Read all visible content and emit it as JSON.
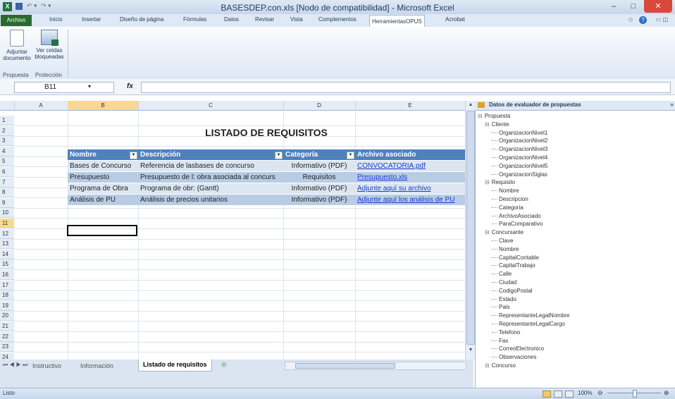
{
  "window": {
    "title": "BASESDEP.con.xls  [Nodo de compatibilidad] - Microsoft Excel",
    "minimize": "–",
    "maximize": "□",
    "close": "✕"
  },
  "menu": {
    "tabs": [
      "Archivo",
      "Inicio",
      "Insertar",
      "Diseño de página",
      "Fórmulas",
      "Datos",
      "Revisar",
      "Vista",
      "Complementos",
      "HerramientasOPUS",
      "Acrobat"
    ]
  },
  "ribbon": {
    "btn_attach": [
      "Adjuntar",
      "documento"
    ],
    "btn_locked": [
      "Ver celdas",
      "bloqueadas"
    ],
    "group_propuesta": "Propuesta",
    "group_proteccion": "Protección"
  },
  "formula": {
    "name_box": "B11",
    "fx": "fx",
    "value": ""
  },
  "grid": {
    "columns": [
      "A",
      "B",
      "C",
      "D",
      "E"
    ],
    "rows": [
      "1",
      "2",
      "3",
      "4",
      "5",
      "6",
      "7",
      "8",
      "9",
      "10",
      "11",
      "12",
      "13",
      "14",
      "15",
      "16",
      "17",
      "18",
      "19",
      "20",
      "21",
      "22",
      "23",
      "24"
    ],
    "title": "LISTADO DE REQUISITOS",
    "table_headers": [
      "Nombre",
      "Descripción",
      "Categoría",
      "Archivo asociado"
    ],
    "table_rows": [
      [
        "Bases de Concurso",
        "Referencia de lasbases de concurso",
        "Informativo (PDF)",
        "CONVOCATORIA.pdf"
      ],
      [
        "Presupuesto",
        "Presupuesto de l: obra asociada al concurs",
        "Requisitos",
        "Presupuesto.xls"
      ],
      [
        "Programa de Obra",
        "Programa de obr: (Gantt)",
        "Informativo (PDF)",
        "Adjunte aquí su archivo"
      ],
      [
        "Análisis de PU",
        "Análisis de precios unitarios",
        "Informativo (PDF)",
        "Adjunte aquí los análisis de PU"
      ]
    ]
  },
  "sheets": {
    "tabs": [
      "Instructivo",
      "Información",
      "Listado de requisitos"
    ]
  },
  "xml_pane": {
    "title": "Datos de evaluador de propuestas",
    "tree": [
      {
        "label": "Propuesta",
        "level": 0,
        "toggle": "⊟"
      },
      {
        "label": "Cliente",
        "level": 1,
        "toggle": "⊟"
      },
      {
        "label": "OrganizacionNivel1",
        "level": 2
      },
      {
        "label": "OrganizacionNivel2",
        "level": 2
      },
      {
        "label": "OrganizacionNivel3",
        "level": 2
      },
      {
        "label": "OrganizacionNivel4",
        "level": 2
      },
      {
        "label": "OrganizacionNivel5",
        "level": 2
      },
      {
        "label": "OrganizacionSiglas",
        "level": 2
      },
      {
        "label": "Requisito",
        "level": 1,
        "toggle": "⊟"
      },
      {
        "label": "Nombre",
        "level": 2
      },
      {
        "label": "Descripcion",
        "level": 2
      },
      {
        "label": "Categoria",
        "level": 2
      },
      {
        "label": "ArchivoAsociado",
        "level": 2
      },
      {
        "label": "ParaComparativo",
        "level": 2
      },
      {
        "label": "Concursante",
        "level": 1,
        "toggle": "⊟"
      },
      {
        "label": "Clave",
        "level": 2
      },
      {
        "label": "Nombre",
        "level": 2
      },
      {
        "label": "CapitalContable",
        "level": 2
      },
      {
        "label": "CapitalTrabajo",
        "level": 2
      },
      {
        "label": "Calle",
        "level": 2
      },
      {
        "label": "Ciudad",
        "level": 2
      },
      {
        "label": "CodigoPostal",
        "level": 2
      },
      {
        "label": "Estado",
        "level": 2
      },
      {
        "label": "Pais",
        "level": 2
      },
      {
        "label": "RepresentanteLegalNombre",
        "level": 2
      },
      {
        "label": "RepresentanteLegalCargo",
        "level": 2
      },
      {
        "label": "Telefono",
        "level": 2
      },
      {
        "label": "Fax",
        "level": 2
      },
      {
        "label": "CorreoElectronico",
        "level": 2
      },
      {
        "label": "Observaciones",
        "level": 2
      },
      {
        "label": "Concurso",
        "level": 1,
        "toggle": "⊟"
      }
    ]
  },
  "status": {
    "ready": "Listo",
    "zoom": "100%"
  }
}
